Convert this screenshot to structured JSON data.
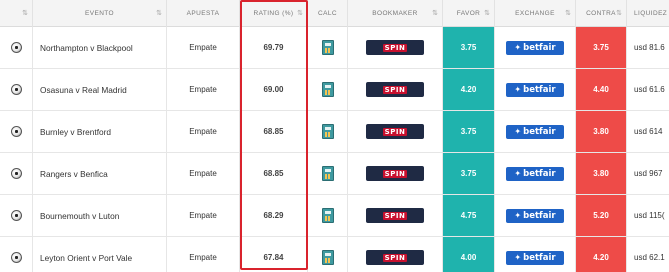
{
  "headers": {
    "sort": "⇅",
    "evento": "EVENTO",
    "apuesta": "APUESTA",
    "rating": "RATING (%)",
    "calc": "CALC",
    "bookmaker": "BOOKMAKER",
    "favor": "FAVOR",
    "exchange": "EXCHANGE",
    "contra": "CONTRA",
    "liquidez": "LIQUIDEZ"
  },
  "bookmaker_logo_text": "SPIN",
  "exchange_logo_text": "betfair",
  "rows": [
    {
      "evento": "Northampton v Blackpool",
      "apuesta": "Empate",
      "rating": "69.79",
      "favor": "3.75",
      "contra": "3.75",
      "liquidez": "usd 81.6"
    },
    {
      "evento": "Osasuna v Real Madrid",
      "apuesta": "Empate",
      "rating": "69.00",
      "favor": "4.20",
      "contra": "4.40",
      "liquidez": "usd 61.6"
    },
    {
      "evento": "Burnley v Brentford",
      "apuesta": "Empate",
      "rating": "68.85",
      "favor": "3.75",
      "contra": "3.80",
      "liquidez": "usd 614"
    },
    {
      "evento": "Rangers v Benfica",
      "apuesta": "Empate",
      "rating": "68.85",
      "favor": "3.75",
      "contra": "3.80",
      "liquidez": "usd 967"
    },
    {
      "evento": "Bournemouth v Luton",
      "apuesta": "Empate",
      "rating": "68.29",
      "favor": "4.75",
      "contra": "5.20",
      "liquidez": "usd 115("
    },
    {
      "evento": "Leyton Orient v Port Vale",
      "apuesta": "Empate",
      "rating": "67.84",
      "favor": "4.00",
      "contra": "4.20",
      "liquidez": "usd 62.1"
    }
  ],
  "colors": {
    "favor": "#1fb3ad",
    "contra": "#ee4b48",
    "highlight": "#d9232d",
    "betfair": "#1f63c6",
    "bookmaker": "#1f2a44"
  }
}
